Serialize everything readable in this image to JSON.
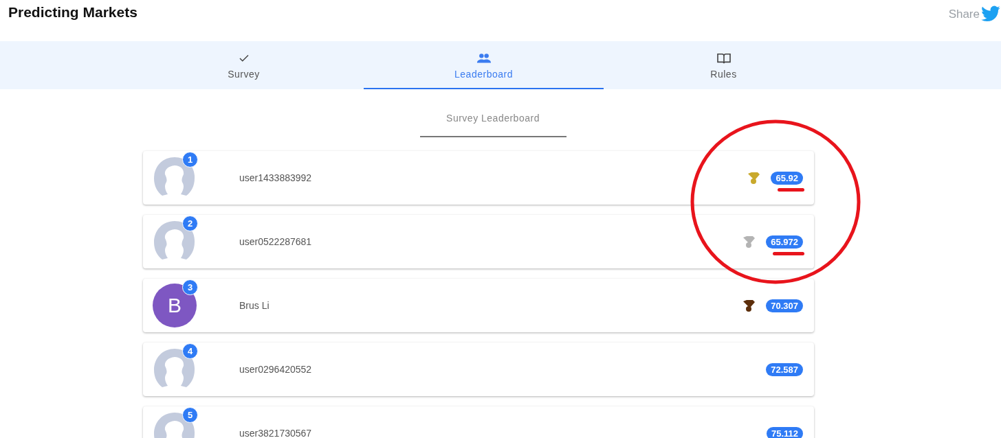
{
  "header": {
    "title": "Predicting Markets",
    "share_label": "Share"
  },
  "tabs": [
    {
      "label": "Survey",
      "selected": false
    },
    {
      "label": "Leaderboard",
      "selected": true
    },
    {
      "label": "Rules",
      "selected": false
    }
  ],
  "section_title": "Survey Leaderboard",
  "rows": [
    {
      "rank": "1",
      "name": "user1433883992",
      "avatar": {
        "kind": "silhouette"
      },
      "color": "#c9a92c",
      "score": "65.92",
      "underlined": true
    },
    {
      "rank": "2",
      "name": "user0522287681",
      "avatar": {
        "kind": "silhouette"
      },
      "color": "#b4b4b4",
      "score": "65.972",
      "underlined": true
    },
    {
      "rank": "3",
      "name": "Brus Li",
      "avatar": {
        "kind": "letter",
        "letter": "B",
        "color": "#7e57c2"
      },
      "color": "#5c2e0b",
      "score": "70.307",
      "underlined": false
    },
    {
      "rank": "4",
      "name": "user0296420552",
      "avatar": {
        "kind": "silhouette"
      },
      "score": "72.587",
      "underlined": false
    },
    {
      "rank": "5",
      "name": "user3821730567",
      "avatar": {
        "kind": "silhouette"
      },
      "score": "75.112",
      "underlined": false
    }
  ]
}
